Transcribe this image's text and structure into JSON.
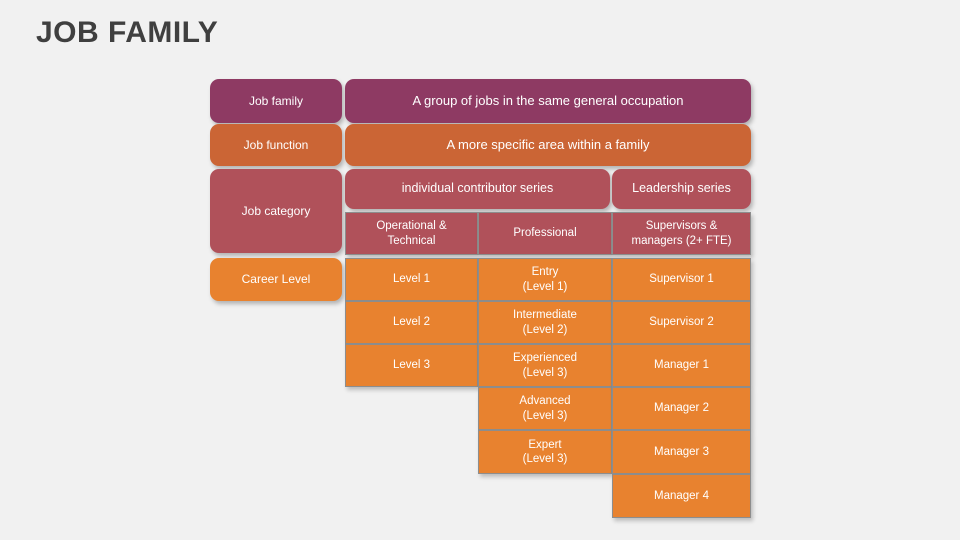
{
  "page": {
    "title": "JOB FAMILY",
    "background_color": "#f1f1f1",
    "title_color": "#3f3f3f"
  },
  "colors": {
    "job_family": "#8e3a63",
    "job_function": "#cb6535",
    "job_category": "#b0515a",
    "career_level": "#e8822f",
    "cell_border": "#8d8d8d",
    "text": "#ffffff"
  },
  "rows": {
    "job_family": {
      "label": "Job family",
      "description": "A group of jobs in the same general occupation"
    },
    "job_function": {
      "label": "Job function",
      "description": "A more specific area within a family"
    },
    "job_category": {
      "label": "Job category",
      "series": [
        {
          "name": "individual contributor series"
        },
        {
          "name": "Leadership series"
        }
      ],
      "subcategories": [
        {
          "line1": "Operational &",
          "line2": "Technical"
        },
        {
          "line1": "Professional",
          "line2": ""
        },
        {
          "line1": "Supervisors &",
          "line2": "managers (2+ FTE)"
        }
      ]
    },
    "career_level": {
      "label": "Career Level",
      "columns": [
        {
          "name": "operational-technical",
          "cells": [
            {
              "line1": "Level 1",
              "line2": ""
            },
            {
              "line1": "Level 2",
              "line2": ""
            },
            {
              "line1": "Level 3",
              "line2": ""
            }
          ]
        },
        {
          "name": "professional",
          "cells": [
            {
              "line1": "Entry",
              "line2": "(Level 1)"
            },
            {
              "line1": "Intermediate",
              "line2": "(Level 2)"
            },
            {
              "line1": "Experienced",
              "line2": "(Level 3)"
            },
            {
              "line1": "Advanced",
              "line2": "(Level 3)"
            },
            {
              "line1": "Expert",
              "line2": "(Level 3)"
            }
          ]
        },
        {
          "name": "supervisors-managers",
          "cells": [
            {
              "line1": "Supervisor 1",
              "line2": ""
            },
            {
              "line1": "Supervisor 2",
              "line2": ""
            },
            {
              "line1": "Manager 1",
              "line2": ""
            },
            {
              "line1": "Manager  2",
              "line2": ""
            },
            {
              "line1": "Manager 3",
              "line2": ""
            },
            {
              "line1": "Manager  4",
              "line2": ""
            }
          ]
        }
      ]
    }
  }
}
